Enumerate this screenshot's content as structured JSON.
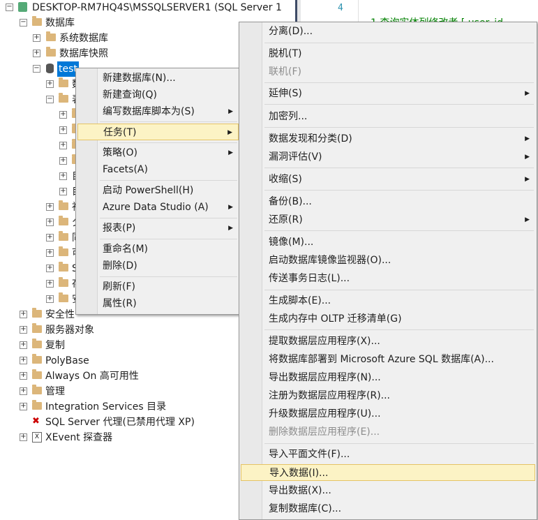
{
  "tree": {
    "server": "DESKTOP-RM7HQ4S\\MSSQLSERVER1 (SQL Server 1",
    "databases": "数据库",
    "system_db": "系统数据库",
    "snapshots": "数据库快照",
    "test_db": "test",
    "truncated": [
      "数",
      "表",
      "",
      "",
      "",
      "",
      "目",
      "目",
      "視",
      "夕",
      "同",
      "可",
      "S",
      "存",
      "安"
    ],
    "security": "安全性",
    "server_objects": "服务器对象",
    "replication": "复制",
    "polybase": "PolyBase",
    "always_on": "Always On 高可用性",
    "management": "管理",
    "integration": "Integration Services 目录",
    "agent": "SQL Server 代理(已禁用代理 XP)",
    "xevent": "XEvent 探查器"
  },
  "editor": {
    "line_number": "4",
    "code_line": "1  查询实体列修改者 [ user_id"
  },
  "context_menu": {
    "items": [
      "新建数据库(N)...",
      "新建查询(Q)",
      "编写数据库脚本为(S)",
      "任务(T)",
      "策略(O)",
      "Facets(A)",
      "启动 PowerShell(H)",
      "Azure Data Studio (A)",
      "报表(P)",
      "重命名(M)",
      "删除(D)",
      "刷新(F)",
      "属性(R)"
    ]
  },
  "tasks_menu": {
    "items": [
      "分离(D)...",
      "脱机(T)",
      "联机(F)",
      "延伸(S)",
      "加密列...",
      "数据发现和分类(D)",
      "漏洞评估(V)",
      "收缩(S)",
      "备份(B)...",
      "还原(R)",
      "镜像(M)...",
      "启动数据库镜像监视器(O)...",
      "传送事务日志(L)...",
      "生成脚本(E)...",
      "生成内存中 OLTP 迁移清单(G)",
      "提取数据层应用程序(X)...",
      "将数据库部署到 Microsoft Azure SQL 数据库(A)...",
      "导出数据层应用程序(N)...",
      "注册为数据层应用程序(R)...",
      "升级数据层应用程序(U)...",
      "删除数据层应用程序(E)...",
      "导入平面文件(F)...",
      "导入数据(I)...",
      "导出数据(X)...",
      "复制数据库(C)..."
    ]
  },
  "colors": {
    "highlight": "#fcf3c5",
    "highlight_border": "#e5c365",
    "selection": "#0078d7",
    "folder": "#dcb67a"
  }
}
